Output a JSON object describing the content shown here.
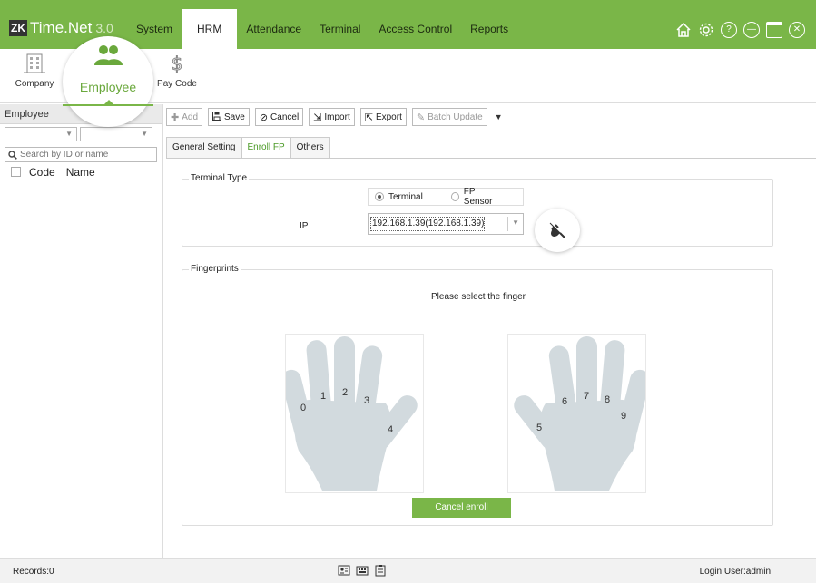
{
  "app": {
    "logo_mark": "ZK",
    "name": "Time.Net",
    "version": "3.0"
  },
  "nav": {
    "items": [
      "System",
      "HRM",
      "Attendance",
      "Terminal",
      "Access Control",
      "Reports"
    ],
    "active": "HRM"
  },
  "window_icons": [
    "home-icon",
    "settings-icon",
    "help-icon",
    "minimize-icon",
    "maximize-icon",
    "close-icon"
  ],
  "ribbon": {
    "company": "Company",
    "employee": "Employee",
    "payroll": "Pay Code"
  },
  "left_panel": {
    "title": "Employee",
    "search_placeholder": "Search by ID or name",
    "col_code": "Code",
    "col_name": "Name"
  },
  "toolbar": {
    "add": "Add",
    "save": "Save",
    "cancel": "Cancel",
    "import": "Import",
    "export": "Export",
    "batch_update": "Batch Update"
  },
  "tabs": {
    "general": "General Setting",
    "enroll": "Enroll FP",
    "others": "Others",
    "active": "Enroll FP"
  },
  "terminal_type": {
    "title": "Terminal Type",
    "option_terminal": "Terminal",
    "option_sensor": "FP Sensor",
    "selected": "Terminal",
    "ip_label": "IP",
    "ip_value": "192.168.1.39(192.168.1.39)"
  },
  "fingerprints": {
    "title": "Fingerprints",
    "prompt": "Please select the finger",
    "left_hand": [
      "0",
      "1",
      "2",
      "3",
      "4"
    ],
    "right_hand": [
      "5",
      "6",
      "7",
      "8",
      "9"
    ],
    "cancel_button": "Cancel enroll"
  },
  "status_bar": {
    "records": "Records:0",
    "login": "Login User:admin"
  },
  "colors": {
    "brand_green": "#7ab648",
    "hand_fill": "#d2dade"
  }
}
